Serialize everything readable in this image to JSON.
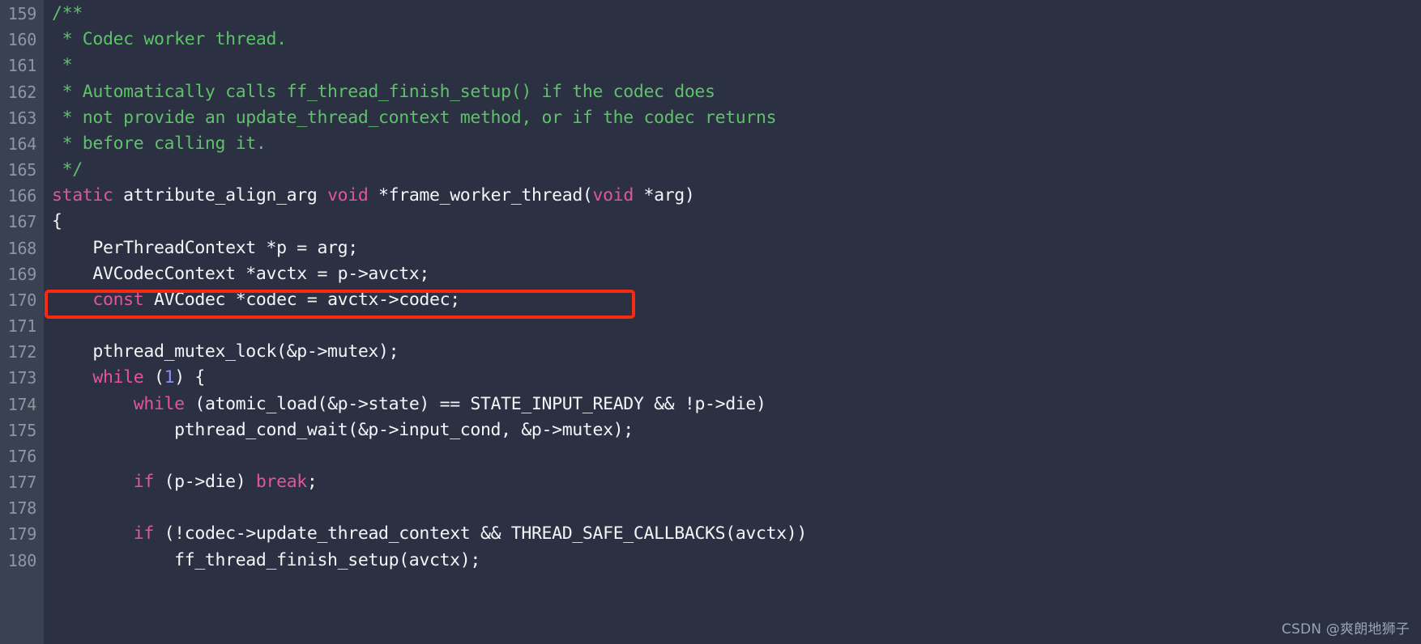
{
  "editor": {
    "theme_colors": {
      "background": "#2b3043",
      "gutter_background": "#3a4150",
      "gutter_text": "#8d96a5",
      "foreground": "#f4f5f7",
      "comment": "#5ec269",
      "keyword": "#e3549f",
      "number": "#8b8ff5",
      "annotation": "#f92a11"
    },
    "first_line_number": 159,
    "last_line_number": 180,
    "lines": [
      {
        "number": "159",
        "tokens": [
          {
            "t": "/**",
            "c": "comment"
          }
        ]
      },
      {
        "number": "160",
        "tokens": [
          {
            "t": " * Codec worker thread.",
            "c": "comment"
          }
        ]
      },
      {
        "number": "161",
        "tokens": [
          {
            "t": " *",
            "c": "comment"
          }
        ]
      },
      {
        "number": "162",
        "tokens": [
          {
            "t": " * Automatically calls ff_thread_finish_setup() if the codec does",
            "c": "comment"
          }
        ]
      },
      {
        "number": "163",
        "tokens": [
          {
            "t": " * not provide an update_thread_context method, or if the codec returns",
            "c": "comment"
          }
        ]
      },
      {
        "number": "164",
        "tokens": [
          {
            "t": " * before calling it.",
            "c": "comment"
          }
        ]
      },
      {
        "number": "165",
        "tokens": [
          {
            "t": " */",
            "c": "comment"
          }
        ]
      },
      {
        "number": "166",
        "tokens": [
          {
            "t": "static",
            "c": "keyword"
          },
          {
            "t": " attribute_align_arg ",
            "c": "plain"
          },
          {
            "t": "void",
            "c": "keyword"
          },
          {
            "t": " *frame_worker_thread(",
            "c": "plain"
          },
          {
            "t": "void",
            "c": "keyword"
          },
          {
            "t": " *arg)",
            "c": "plain"
          }
        ]
      },
      {
        "number": "167",
        "tokens": [
          {
            "t": "{",
            "c": "plain"
          }
        ]
      },
      {
        "number": "168",
        "tokens": [
          {
            "t": "    PerThreadContext *p = arg;",
            "c": "plain"
          }
        ]
      },
      {
        "number": "169",
        "tokens": [
          {
            "t": "    AVCodecContext *avctx = p->avctx;",
            "c": "plain"
          }
        ]
      },
      {
        "number": "170",
        "tokens": [
          {
            "t": "    ",
            "c": "plain"
          },
          {
            "t": "const",
            "c": "keyword"
          },
          {
            "t": " AVCodec *codec = avctx->codec;",
            "c": "plain"
          }
        ]
      },
      {
        "number": "171",
        "tokens": [
          {
            "t": "",
            "c": "plain"
          }
        ]
      },
      {
        "number": "172",
        "tokens": [
          {
            "t": "    pthread_mutex_lock(&p->mutex);",
            "c": "plain"
          }
        ]
      },
      {
        "number": "173",
        "tokens": [
          {
            "t": "    ",
            "c": "plain"
          },
          {
            "t": "while",
            "c": "keyword"
          },
          {
            "t": " (",
            "c": "plain"
          },
          {
            "t": "1",
            "c": "number"
          },
          {
            "t": ") {",
            "c": "plain"
          }
        ]
      },
      {
        "number": "174",
        "tokens": [
          {
            "t": "        ",
            "c": "plain"
          },
          {
            "t": "while",
            "c": "keyword"
          },
          {
            "t": " (atomic_load(&p->state) == STATE_INPUT_READY && !p->die)",
            "c": "plain"
          }
        ]
      },
      {
        "number": "175",
        "tokens": [
          {
            "t": "            pthread_cond_wait(&p->input_cond, &p->mutex);",
            "c": "plain"
          }
        ]
      },
      {
        "number": "176",
        "tokens": [
          {
            "t": "",
            "c": "plain"
          }
        ]
      },
      {
        "number": "177",
        "tokens": [
          {
            "t": "        ",
            "c": "plain"
          },
          {
            "t": "if",
            "c": "keyword"
          },
          {
            "t": " (p->die) ",
            "c": "plain"
          },
          {
            "t": "break",
            "c": "keyword"
          },
          {
            "t": ";",
            "c": "plain"
          }
        ]
      },
      {
        "number": "178",
        "tokens": [
          {
            "t": "",
            "c": "plain"
          }
        ]
      },
      {
        "number": "179",
        "tokens": [
          {
            "t": "        ",
            "c": "plain"
          },
          {
            "t": "if",
            "c": "keyword"
          },
          {
            "t": " (!codec->update_thread_context && THREAD_SAFE_CALLBACKS(avctx))",
            "c": "plain"
          }
        ]
      },
      {
        "number": "180",
        "tokens": [
          {
            "t": "            ff_thread_finish_setup(avctx);",
            "c": "plain"
          }
        ]
      }
    ]
  },
  "annotation": {
    "type": "rectangle-highlight",
    "target_line": "170",
    "color": "#f92a11"
  },
  "watermark": {
    "text": "CSDN @爽朗地狮子"
  }
}
